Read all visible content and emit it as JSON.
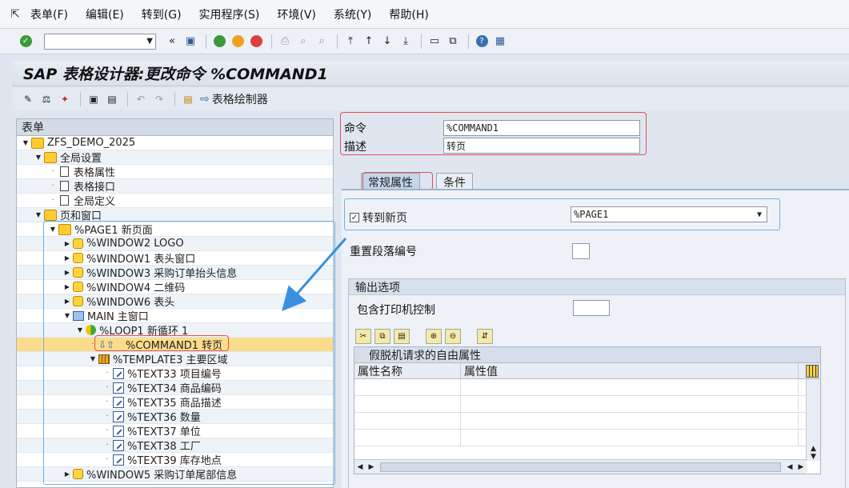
{
  "menubar": {
    "items": [
      "表单(F)",
      "编辑(E)",
      "转到(G)",
      "实用程序(S)",
      "环境(V)",
      "系统(Y)",
      "帮助(H)"
    ]
  },
  "title": "SAP 表格设计器:更改命令 %COMMAND1",
  "app_toolbar": {
    "form_painter_label": "表格绘制器"
  },
  "tree": {
    "header": "表单",
    "nodes": [
      {
        "text": "ZFS_DEMO_2025"
      },
      {
        "text": "全局设置"
      },
      {
        "text": "表格属性"
      },
      {
        "text": "表格接口"
      },
      {
        "text": "全局定义"
      },
      {
        "text": "页和窗口"
      },
      {
        "text": "%PAGE1 新页面"
      },
      {
        "text": "%WINDOW2 LOGO"
      },
      {
        "text": "%WINDOW1 表头窗口"
      },
      {
        "text": "%WINDOW3 采购订单抬头信息"
      },
      {
        "text": "%WINDOW4 二维码"
      },
      {
        "text": "%WINDOW6 表头"
      },
      {
        "text": "MAIN 主窗口"
      },
      {
        "text": "%LOOP1 新循环 1"
      },
      {
        "text": "%COMMAND1 转页"
      },
      {
        "text": "%TEMPLATE3 主要区域"
      },
      {
        "text": "%TEXT33 项目编号"
      },
      {
        "text": "%TEXT34 商品编码"
      },
      {
        "text": "%TEXT35 商品描述"
      },
      {
        "text": "%TEXT36 数量"
      },
      {
        "text": "%TEXT37 单位"
      },
      {
        "text": "%TEXT38 工厂"
      },
      {
        "text": "%TEXT39 库存地点"
      },
      {
        "text": "%WINDOW5 采购订单尾部信息"
      }
    ]
  },
  "detail": {
    "command_label": "命令",
    "command_value": "%COMMAND1",
    "desc_label": "描述",
    "desc_value": "转页",
    "tabs": [
      "常规属性",
      "条件"
    ],
    "goto_page_label": "转到新页",
    "goto_page_value": "%PAGE1",
    "reset_para_label": "重置段落编号",
    "output_group_title": "输出选项",
    "printer_ctrl_label": "包含打印机控制",
    "table_title": "假脱机请求的自由属性",
    "table_cols": [
      "属性名称",
      "属性值"
    ]
  },
  "colors": {
    "highlight_red": "#e05050",
    "highlight_blue": "#6ab0e8",
    "selected_row": "#fbdc8c"
  }
}
